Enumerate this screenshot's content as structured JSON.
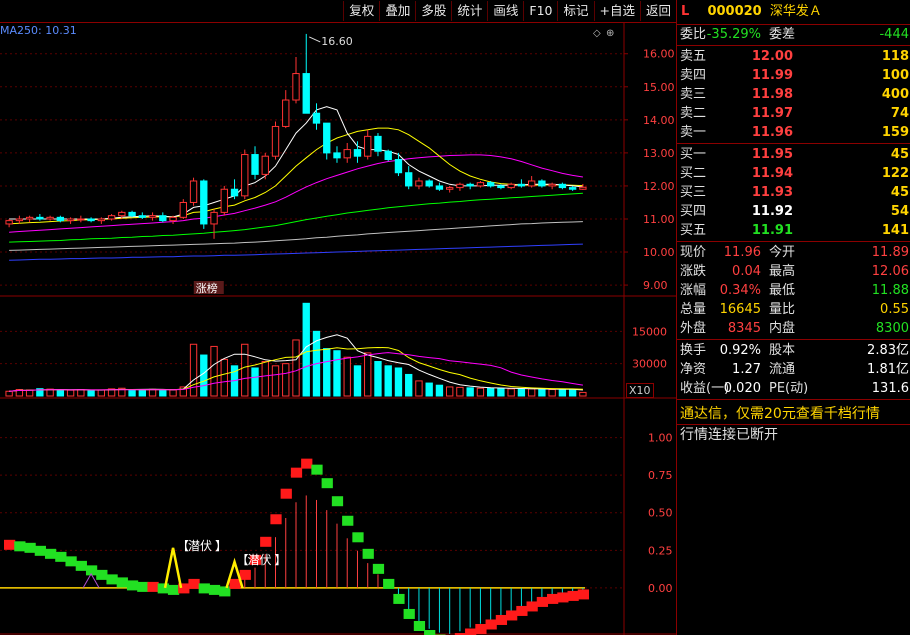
{
  "toolbar": {
    "buttons": [
      "复权",
      "叠加",
      "多股",
      "统计",
      "画线",
      "F10",
      "标记",
      "+自选",
      "返回"
    ]
  },
  "main_chart": {
    "ma_label": "MA250: 10.31",
    "max_label": "16.60",
    "price_ticks": [
      "16.00",
      "15.00",
      "14.00",
      "13.00",
      "12.00",
      "11.00",
      "10.00",
      "9.00"
    ],
    "limit_up_tag": "涨榜"
  },
  "volume_chart": {
    "ticks": [
      "30000",
      "15000"
    ],
    "scale_label": "X10"
  },
  "indicator_chart": {
    "ticks": [
      "1.00",
      "0.75",
      "0.50",
      "0.25",
      "0.00"
    ],
    "signal_labels": [
      "潜伏",
      "潜伏"
    ]
  },
  "quote_panel": {
    "marker": "L",
    "code": "000020",
    "name": "深华发Ａ",
    "weibi_label": "委比",
    "weibi_value": "-35.29%",
    "weicha_label": "委差",
    "weicha_value": "-444",
    "asks": [
      {
        "label": "卖五",
        "price": "12.00",
        "vol": "118"
      },
      {
        "label": "卖四",
        "price": "11.99",
        "vol": "100"
      },
      {
        "label": "卖三",
        "price": "11.98",
        "vol": "400"
      },
      {
        "label": "卖二",
        "price": "11.97",
        "vol": "74"
      },
      {
        "label": "卖一",
        "price": "11.96",
        "vol": "159"
      }
    ],
    "bids": [
      {
        "label": "买一",
        "price": "11.95",
        "vol": "45"
      },
      {
        "label": "买二",
        "price": "11.94",
        "vol": "122"
      },
      {
        "label": "买三",
        "price": "11.93",
        "vol": "45"
      },
      {
        "label": "买四",
        "price": "11.92",
        "vol": "54"
      },
      {
        "label": "买五",
        "price": "11.91",
        "vol": "141"
      }
    ],
    "stats1": [
      {
        "l1": "现价",
        "v1": "11.96",
        "l2": "今开",
        "v2": "11.89"
      },
      {
        "l1": "涨跌",
        "v1": "0.04",
        "l2": "最高",
        "v2": "12.06"
      },
      {
        "l1": "涨幅",
        "v1": "0.34%",
        "l2": "最低",
        "v2": "11.88"
      },
      {
        "l1": "总量",
        "v1": "16645",
        "l2": "量比",
        "v2": "0.55"
      },
      {
        "l1": "外盘",
        "v1": "8345",
        "l2": "内盘",
        "v2": "8300"
      }
    ],
    "stats2": [
      {
        "l1": "换手",
        "v1": "0.92%",
        "l2": "股本",
        "v2": "2.83亿"
      },
      {
        "l1": "净资",
        "v1": "1.27",
        "l2": "流通",
        "v2": "1.81亿"
      },
      {
        "l1": "收益(一)",
        "v1": "0.020",
        "l2": "PE(动)",
        "v2": "131.6"
      }
    ],
    "ad_text": "通达信，仅需20元查看千档行情",
    "status_text": "行情连接已断开"
  },
  "colors": {
    "up": "#ff3333",
    "down": "#00ffff",
    "frame": "#8b0000",
    "ma5": "#ffffff",
    "ma10": "#ffff00",
    "ma20": "#ff00ff",
    "ma60": "#00ff00",
    "ma120": "#c0c0c0",
    "ma250": "#3040ff"
  },
  "chart_data": [
    {
      "type": "candlestick",
      "title": "",
      "ylim": [
        8.7,
        16.9
      ],
      "y_ticks": [
        9,
        10,
        11,
        12,
        13,
        14,
        15,
        16
      ],
      "series_ohlc": [
        [
          10.85,
          11.0,
          10.75,
          10.95
        ],
        [
          10.95,
          11.1,
          10.85,
          11.0
        ],
        [
          11.0,
          11.1,
          10.9,
          11.05
        ],
        [
          11.05,
          11.15,
          10.95,
          11.0
        ],
        [
          11.0,
          11.1,
          10.95,
          11.05
        ],
        [
          11.05,
          11.1,
          10.9,
          10.95
        ],
        [
          10.95,
          11.05,
          10.85,
          11.0
        ],
        [
          11.0,
          11.1,
          10.9,
          11.0
        ],
        [
          11.0,
          11.05,
          10.9,
          10.95
        ],
        [
          10.95,
          11.05,
          10.85,
          11.0
        ],
        [
          11.0,
          11.15,
          10.95,
          11.1
        ],
        [
          11.1,
          11.25,
          11.0,
          11.2
        ],
        [
          11.2,
          11.25,
          11.05,
          11.1
        ],
        [
          11.1,
          11.2,
          11.0,
          11.05
        ],
        [
          11.05,
          11.2,
          10.95,
          11.1
        ],
        [
          11.1,
          11.2,
          10.9,
          10.95
        ],
        [
          10.95,
          11.1,
          10.85,
          11.05
        ],
        [
          11.05,
          11.6,
          11.0,
          11.5
        ],
        [
          11.5,
          12.25,
          11.4,
          12.15
        ],
        [
          12.15,
          12.2,
          10.7,
          10.85
        ],
        [
          10.85,
          11.3,
          10.4,
          11.2
        ],
        [
          11.2,
          12.0,
          11.1,
          11.9
        ],
        [
          11.9,
          12.2,
          11.6,
          11.7
        ],
        [
          11.7,
          13.1,
          11.6,
          12.95
        ],
        [
          12.95,
          13.2,
          12.2,
          12.35
        ],
        [
          12.35,
          13.0,
          12.2,
          12.9
        ],
        [
          12.9,
          13.95,
          12.8,
          13.8
        ],
        [
          13.8,
          14.9,
          13.75,
          14.6
        ],
        [
          14.6,
          15.9,
          14.5,
          15.4
        ],
        [
          15.4,
          16.6,
          14.8,
          14.2
        ],
        [
          14.2,
          14.5,
          13.7,
          13.9
        ],
        [
          13.9,
          13.9,
          12.8,
          13.0
        ],
        [
          13.0,
          13.2,
          12.7,
          12.85
        ],
        [
          12.85,
          13.3,
          12.7,
          13.1
        ],
        [
          13.1,
          13.35,
          12.7,
          12.9
        ],
        [
          12.9,
          13.7,
          12.8,
          13.5
        ],
        [
          13.5,
          13.6,
          12.9,
          13.05
        ],
        [
          13.05,
          13.1,
          12.75,
          12.8
        ],
        [
          12.8,
          13.0,
          12.3,
          12.4
        ],
        [
          12.4,
          12.6,
          11.9,
          12.0
        ],
        [
          12.0,
          12.25,
          11.9,
          12.15
        ],
        [
          12.15,
          12.2,
          11.95,
          12.0
        ],
        [
          12.0,
          12.1,
          11.85,
          11.9
        ],
        [
          11.9,
          12.0,
          11.8,
          11.95
        ],
        [
          11.95,
          12.1,
          11.85,
          12.05
        ],
        [
          12.05,
          12.1,
          11.9,
          12.0
        ],
        [
          12.0,
          12.15,
          11.95,
          12.1
        ],
        [
          12.1,
          12.15,
          11.95,
          12.0
        ],
        [
          12.0,
          12.05,
          11.9,
          11.95
        ],
        [
          11.95,
          12.1,
          11.9,
          12.05
        ],
        [
          12.05,
          12.2,
          11.95,
          12.0
        ],
        [
          12.0,
          12.3,
          11.95,
          12.15
        ],
        [
          12.15,
          12.2,
          11.95,
          12.0
        ],
        [
          12.0,
          12.1,
          11.9,
          12.05
        ],
        [
          12.05,
          12.1,
          11.9,
          11.95
        ],
        [
          11.95,
          12.0,
          11.85,
          11.9
        ],
        [
          11.9,
          12.06,
          11.88,
          11.96
        ]
      ],
      "ma5": [
        11.0,
        11.0,
        11.0,
        11.0,
        11.0,
        11.0,
        11.0,
        11.0,
        11.0,
        11.0,
        11.02,
        11.05,
        11.07,
        11.08,
        11.1,
        11.08,
        11.06,
        11.15,
        11.35,
        11.4,
        11.5,
        11.6,
        11.7,
        12.0,
        12.1,
        12.3,
        12.6,
        13.1,
        13.6,
        13.9,
        14.3,
        14.4,
        14.3,
        13.6,
        13.2,
        13.1,
        13.1,
        13.05,
        12.95,
        12.65,
        12.45,
        12.3,
        12.15,
        12.05,
        12.0,
        12.0,
        12.0,
        12.02,
        12.02,
        12.02,
        12.03,
        12.05,
        12.05,
        12.05,
        12.03,
        12.0,
        11.97
      ],
      "ma10": [
        10.85,
        10.87,
        10.89,
        10.9,
        10.92,
        10.94,
        10.95,
        10.97,
        10.98,
        10.99,
        11.0,
        11.02,
        11.04,
        11.05,
        11.06,
        11.07,
        11.07,
        11.1,
        11.2,
        11.22,
        11.3,
        11.37,
        11.42,
        11.55,
        11.65,
        11.8,
        12.0,
        12.3,
        12.6,
        12.85,
        13.1,
        13.3,
        13.45,
        13.55,
        13.65,
        13.7,
        13.75,
        13.75,
        13.7,
        13.55,
        13.35,
        13.15,
        12.9,
        12.65,
        12.45,
        12.3,
        12.2,
        12.12,
        12.07,
        12.05,
        12.03,
        12.02,
        12.03,
        12.03,
        12.03,
        12.02,
        12.01
      ],
      "ma20": [
        10.6,
        10.62,
        10.64,
        10.66,
        10.68,
        10.7,
        10.72,
        10.74,
        10.76,
        10.78,
        10.8,
        10.82,
        10.84,
        10.86,
        10.88,
        10.9,
        10.92,
        10.95,
        11.0,
        11.02,
        11.07,
        11.12,
        11.17,
        11.25,
        11.33,
        11.42,
        11.52,
        11.66,
        11.82,
        11.97,
        12.1,
        12.22,
        12.32,
        12.42,
        12.52,
        12.6,
        12.68,
        12.74,
        12.78,
        12.82,
        12.85,
        12.88,
        12.9,
        12.92,
        12.93,
        12.94,
        12.94,
        12.92,
        12.88,
        12.82,
        12.74,
        12.64,
        12.54,
        12.46,
        12.38,
        12.32,
        12.27
      ],
      "ma60": [
        10.3,
        10.31,
        10.32,
        10.33,
        10.34,
        10.35,
        10.37,
        10.38,
        10.4,
        10.41,
        10.42,
        10.44,
        10.45,
        10.47,
        10.48,
        10.5,
        10.51,
        10.53,
        10.55,
        10.57,
        10.6,
        10.62,
        10.65,
        10.68,
        10.72,
        10.76,
        10.8,
        10.86,
        10.92,
        10.98,
        11.03,
        11.08,
        11.13,
        11.18,
        11.22,
        11.26,
        11.3,
        11.34,
        11.37,
        11.4,
        11.43,
        11.46,
        11.48,
        11.51,
        11.53,
        11.56,
        11.58,
        11.6,
        11.62,
        11.64,
        11.66,
        11.68,
        11.7,
        11.72,
        11.74,
        11.76,
        11.78
      ],
      "ma120": [
        10.05,
        10.06,
        10.07,
        10.08,
        10.09,
        10.1,
        10.11,
        10.12,
        10.13,
        10.14,
        10.15,
        10.16,
        10.17,
        10.18,
        10.19,
        10.2,
        10.21,
        10.22,
        10.23,
        10.24,
        10.25,
        10.26,
        10.27,
        10.29,
        10.3,
        10.32,
        10.34,
        10.36,
        10.38,
        10.4,
        10.43,
        10.45,
        10.48,
        10.5,
        10.52,
        10.55,
        10.57,
        10.59,
        10.61,
        10.63,
        10.65,
        10.67,
        10.69,
        10.71,
        10.73,
        10.75,
        10.77,
        10.79,
        10.81,
        10.83,
        10.85,
        10.86,
        10.88,
        10.89,
        10.9,
        10.91,
        10.92
      ],
      "ma250": [
        9.75,
        9.76,
        9.77,
        9.78,
        9.78,
        9.79,
        9.8,
        9.8,
        9.81,
        9.82,
        9.82,
        9.83,
        9.84,
        9.84,
        9.85,
        9.86,
        9.86,
        9.87,
        9.88,
        9.88,
        9.89,
        9.9,
        9.9,
        9.91,
        9.92,
        9.93,
        9.94,
        9.95,
        9.96,
        9.97,
        9.98,
        9.99,
        10.0,
        10.01,
        10.02,
        10.03,
        10.04,
        10.05,
        10.06,
        10.07,
        10.08,
        10.09,
        10.1,
        10.11,
        10.12,
        10.13,
        10.14,
        10.15,
        10.16,
        10.17,
        10.18,
        10.19,
        10.2,
        10.21,
        10.22,
        10.23,
        10.24
      ]
    },
    {
      "type": "bar",
      "ylim": [
        0,
        45000
      ],
      "y_ticks": [
        15000,
        30000
      ],
      "values": [
        2200,
        3000,
        2800,
        3400,
        3200,
        2600,
        2700,
        3000,
        2500,
        2800,
        3300,
        3600,
        2900,
        2800,
        3100,
        3000,
        2800,
        4200,
        24000,
        19000,
        23000,
        17000,
        14000,
        24000,
        13000,
        16000,
        14000,
        15000,
        26000,
        43000,
        30000,
        22000,
        21000,
        18000,
        14000,
        20000,
        16000,
        14000,
        13000,
        10000,
        7000,
        6000,
        5000,
        4200,
        4000,
        3800,
        3600,
        3700,
        3500,
        3300,
        3200,
        3300,
        3100,
        3000,
        3200,
        3000,
        1664
      ]
    },
    {
      "type": "bar",
      "title": "",
      "ylim": [
        -0.3,
        1.25
      ],
      "y_ticks": [
        0,
        0.25,
        0.5,
        0.75,
        1.0
      ],
      "values": [
        0.28,
        0.27,
        0.26,
        0.24,
        0.22,
        0.2,
        0.17,
        0.14,
        0.11,
        0.08,
        0.05,
        0.03,
        0.01,
        0.0,
        0.0,
        -0.01,
        -0.02,
        -0.01,
        0.02,
        -0.01,
        -0.02,
        -0.03,
        0.02,
        0.08,
        0.18,
        0.3,
        0.45,
        0.62,
        0.76,
        0.82,
        0.78,
        0.69,
        0.57,
        0.44,
        0.33,
        0.22,
        0.12,
        0.02,
        -0.08,
        -0.18,
        -0.26,
        -0.32,
        -0.35,
        -0.36,
        -0.34,
        -0.31,
        -0.28,
        -0.25,
        -0.22,
        -0.19,
        -0.16,
        -0.13,
        -0.1,
        -0.08,
        -0.07,
        -0.06,
        -0.05
      ]
    }
  ]
}
